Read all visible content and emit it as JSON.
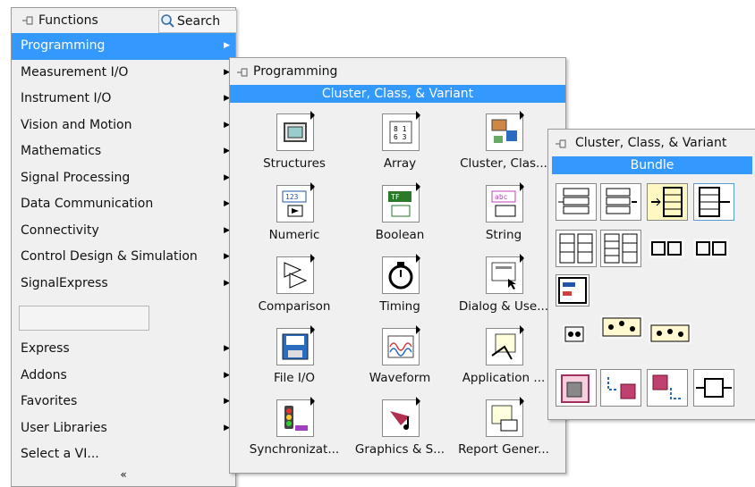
{
  "functions": {
    "title": "Functions",
    "search_label": "Search",
    "items": [
      {
        "label": "Programming",
        "selected": true
      },
      {
        "label": "Measurement I/O"
      },
      {
        "label": "Instrument I/O"
      },
      {
        "label": "Vision and Motion"
      },
      {
        "label": "Mathematics"
      },
      {
        "label": "Signal Processing"
      },
      {
        "label": "Data Communication"
      },
      {
        "label": "Connectivity"
      },
      {
        "label": "Control Design & Simulation"
      },
      {
        "label": "SignalExpress"
      }
    ],
    "items2": [
      {
        "label": "Express"
      },
      {
        "label": "Addons"
      },
      {
        "label": "Favorites"
      },
      {
        "label": "User Libraries"
      },
      {
        "label": "Select a VI..."
      }
    ],
    "collapse_glyph": "«"
  },
  "programming": {
    "title": "Programming",
    "selected": "Cluster, Class, & Variant",
    "items": [
      "Structures",
      "Array",
      "Cluster, Clas...",
      "Numeric",
      "Boolean",
      "String",
      "Comparison",
      "Timing",
      "Dialog & Use...",
      "File I/O",
      "Waveform",
      "Application ...",
      "Synchronizat...",
      "Graphics & S...",
      "Report Gener..."
    ]
  },
  "cluster": {
    "title": "Cluster, Class, & Variant",
    "selected": "Bundle"
  },
  "colors": {
    "selection": "#3399ff",
    "panel_bg": "#f0f0f0"
  }
}
